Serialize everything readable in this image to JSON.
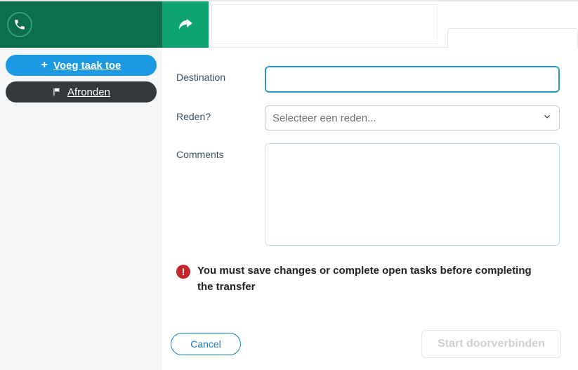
{
  "sidebar": {
    "add_task_label": "Voeg taak toe",
    "finish_label": "Afronden"
  },
  "form": {
    "destination_label": "Destination",
    "destination_value": "",
    "reason_label": "Reden?",
    "reason_placeholder": "Selecteer een reden...",
    "comments_label": "Comments",
    "comments_value": ""
  },
  "warning": {
    "text": "You must save changes or complete open tasks before completing the transfer"
  },
  "footer": {
    "cancel_label": "Cancel",
    "start_label": "Start doorverbinden"
  }
}
